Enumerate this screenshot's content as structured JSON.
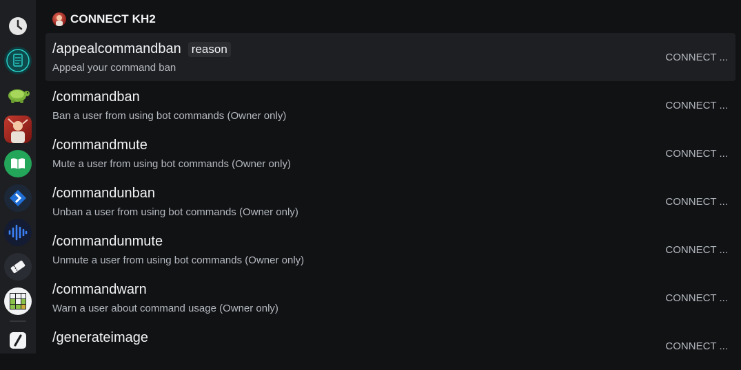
{
  "sidebar": {
    "items": [
      {
        "icon": "clock-icon"
      },
      {
        "icon": "clipboard-checklist-icon"
      },
      {
        "icon": "turtle-icon"
      },
      {
        "icon": "server-avatar-icon"
      },
      {
        "icon": "book-icon"
      },
      {
        "icon": "diamond-arrow-icon"
      },
      {
        "icon": "sound-wave-icon"
      },
      {
        "icon": "ticket-icon"
      },
      {
        "icon": "grid-icon"
      },
      {
        "icon": "slash-icon"
      }
    ]
  },
  "header": {
    "title": "CONNECT KH2"
  },
  "commands": [
    {
      "name": "/appealcommandban",
      "option": "reason",
      "description": "Appeal your command ban",
      "app": "CONNECT ..."
    },
    {
      "name": "/commandban",
      "option": "",
      "description": "Ban a user from using bot commands (Owner only)",
      "app": "CONNECT ..."
    },
    {
      "name": "/commandmute",
      "option": "",
      "description": "Mute a user from using bot commands (Owner only)",
      "app": "CONNECT ..."
    },
    {
      "name": "/commandunban",
      "option": "",
      "description": "Unban a user from using bot commands (Owner only)",
      "app": "CONNECT ..."
    },
    {
      "name": "/commandunmute",
      "option": "",
      "description": "Unmute a user from using bot commands (Owner only)",
      "app": "CONNECT ..."
    },
    {
      "name": "/commandwarn",
      "option": "",
      "description": "Warn a user about command usage (Owner only)",
      "app": "CONNECT ..."
    },
    {
      "name": "/generateimage",
      "option": "",
      "description": "",
      "app": "CONNECT ..."
    }
  ],
  "colors": {
    "background": "#111214",
    "rail": "#1e1f22",
    "selected": "#1e1f22",
    "accent_green": "#23a55a",
    "accent_blue": "#3b82f6"
  }
}
